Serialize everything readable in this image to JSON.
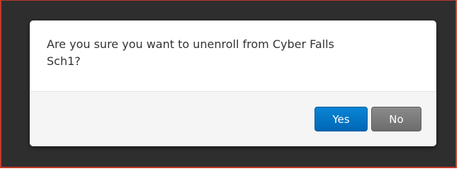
{
  "dialog": {
    "message_line1": "Are you sure you want to unenroll from Cyber Falls",
    "message_line2": "Sch1?",
    "yes_label": "Yes",
    "no_label": "No"
  },
  "colors": {
    "overlay": "#2e2e2e",
    "overlay_border": "#c0392b",
    "yes_button": "#0a7ad0",
    "no_button": "#7a7a7a",
    "footer": "#f5f5f5"
  }
}
